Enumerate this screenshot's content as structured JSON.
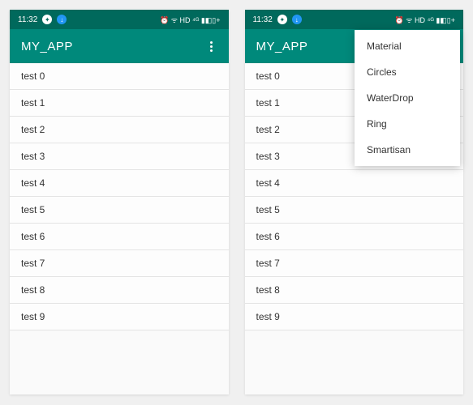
{
  "status": {
    "time": "11:32",
    "indicators_right": "⏰ ᯤ HD ⁴ᴳ ▮◧▯+"
  },
  "appbar": {
    "title": "MY_APP"
  },
  "list": {
    "items": [
      {
        "label": "test 0"
      },
      {
        "label": "test 1"
      },
      {
        "label": "test 2"
      },
      {
        "label": "test 3"
      },
      {
        "label": "test 4"
      },
      {
        "label": "test 5"
      },
      {
        "label": "test 6"
      },
      {
        "label": "test 7"
      },
      {
        "label": "test 8"
      },
      {
        "label": "test 9"
      }
    ]
  },
  "menu": {
    "items": [
      {
        "label": "Material"
      },
      {
        "label": "Circles"
      },
      {
        "label": "WaterDrop"
      },
      {
        "label": "Ring"
      },
      {
        "label": "Smartisan"
      }
    ]
  }
}
